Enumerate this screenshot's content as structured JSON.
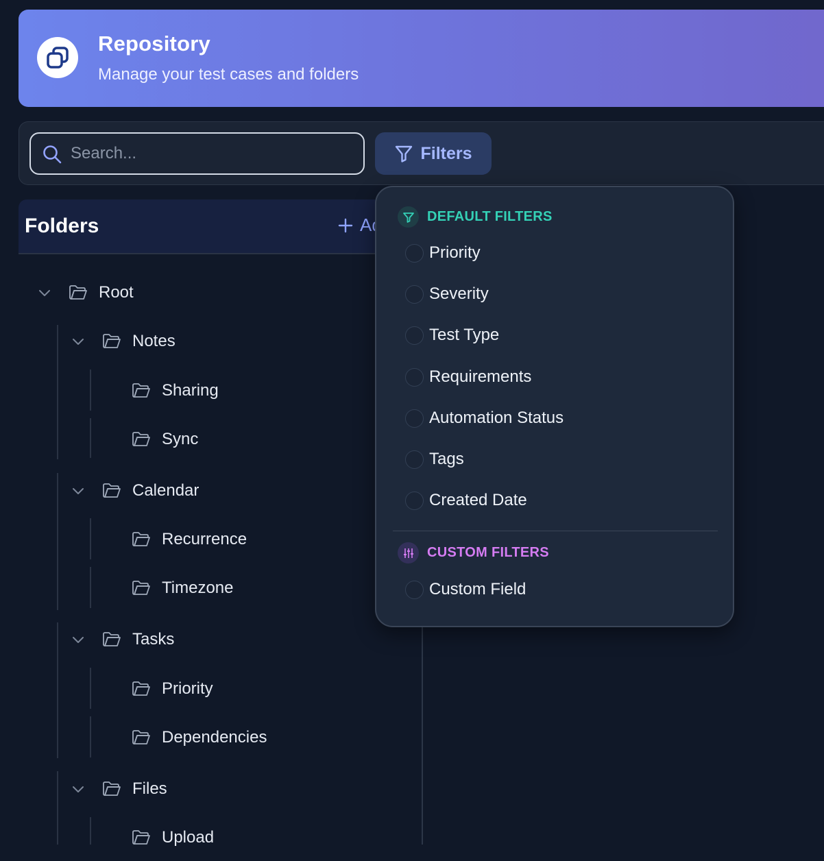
{
  "header": {
    "title": "Repository",
    "subtitle": "Manage your test cases and folders",
    "logo_icon": "copy-icon",
    "gradient": [
      "#6d84ec",
      "#7167cc"
    ]
  },
  "toolbar": {
    "search_placeholder": "Search...",
    "search_value": "",
    "filters_label": "Filters"
  },
  "folders": {
    "title": "Folders",
    "add_label": "Add",
    "tree": [
      {
        "label": "Root",
        "level": 0,
        "expanded": true
      },
      {
        "label": "Notes",
        "level": 1,
        "expanded": true
      },
      {
        "label": "Sharing",
        "level": 2
      },
      {
        "label": "Sync",
        "level": 2
      },
      {
        "label": "Calendar",
        "level": 1,
        "expanded": true
      },
      {
        "label": "Recurrence",
        "level": 2
      },
      {
        "label": "Timezone",
        "level": 2
      },
      {
        "label": "Tasks",
        "level": 1,
        "expanded": true
      },
      {
        "label": "Priority",
        "level": 2
      },
      {
        "label": "Dependencies",
        "level": 2
      },
      {
        "label": "Files",
        "level": 1,
        "expanded": true
      },
      {
        "label": "Upload",
        "level": 2
      }
    ]
  },
  "filters_menu": {
    "default_title": "DEFAULT FILTERS",
    "default_color": "#34d1b6",
    "default_options": [
      {
        "label": "Priority",
        "checked": false
      },
      {
        "label": "Severity",
        "checked": false
      },
      {
        "label": "Test Type",
        "checked": false
      },
      {
        "label": "Requirements",
        "checked": false
      },
      {
        "label": "Automation Status",
        "checked": false
      },
      {
        "label": "Tags",
        "checked": false
      },
      {
        "label": "Created Date",
        "checked": false
      }
    ],
    "custom_title": "CUSTOM FILTERS",
    "custom_color": "#d57cf2",
    "custom_options": [
      {
        "label": "Custom Field",
        "checked": false
      }
    ]
  }
}
